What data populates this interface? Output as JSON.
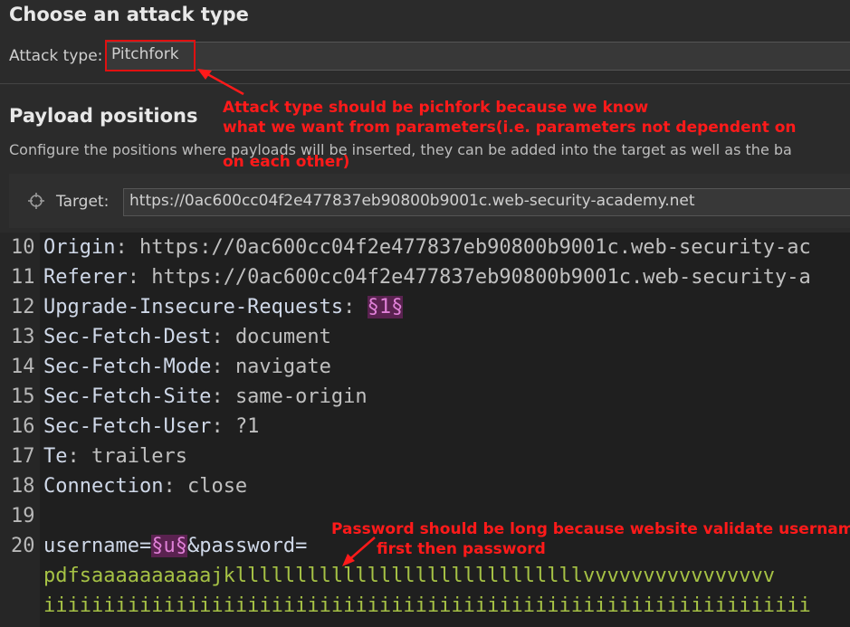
{
  "attack_type_section": {
    "title": "Choose an attack type",
    "label": "Attack type:",
    "value": "Pitchfork"
  },
  "payload_section": {
    "title": "Payload positions",
    "description": "Configure the positions where payloads will be inserted, they can be added into the target as well as the ba"
  },
  "target": {
    "label": "Target:",
    "url": "https://0ac600cc04f2e477837eb90800b9001c.web-security-academy.net"
  },
  "annotations": {
    "attack_type_note": [
      "Attack type should be pichfork because we know",
      "what we want from parameters(i.e. parameters not dependent on",
      "on each other)"
    ],
    "password_note": [
      "Password should be long because website validate username",
      "first then password"
    ],
    "color": "#ff1a1a"
  },
  "request_lines": [
    {
      "num": "10",
      "key": "Origin",
      "sep": ": ",
      "val": "https://0ac600cc04f2e477837eb90800b9001c.web-security-ac"
    },
    {
      "num": "11",
      "key": "Referer",
      "sep": ": ",
      "val": "https://0ac600cc04f2e477837eb90800b9001c.web-security-a"
    },
    {
      "num": "12",
      "key": "Upgrade-Insecure-Requests",
      "sep": ": ",
      "marker": "§1§"
    },
    {
      "num": "13",
      "key": "Sec-Fetch-Dest",
      "sep": ": ",
      "val": "document"
    },
    {
      "num": "14",
      "key": "Sec-Fetch-Mode",
      "sep": ": ",
      "val": "navigate"
    },
    {
      "num": "15",
      "key": "Sec-Fetch-Site",
      "sep": ": ",
      "val": "same-origin"
    },
    {
      "num": "16",
      "key": "Sec-Fetch-User",
      "sep": ": ",
      "val": "?1"
    },
    {
      "num": "17",
      "key": "Te",
      "sep": ": ",
      "val": "trailers"
    },
    {
      "num": "18",
      "key": "Connection",
      "sep": ": ",
      "val": "close"
    },
    {
      "num": "19"
    },
    {
      "num": "20",
      "body_prefix": "username=",
      "marker": "§u§",
      "body_suffix": "&password="
    }
  ],
  "password_lines": [
    "pdfsaaaaaaaaaajklllllllllllllllllllllllllllllvvvvvvvvvvvvvvvv",
    "iiiiiiiiiiiiiiiiiiiiiiiiiiiiiiiiiiiiiiiiiiiiiiiiiiiiiiiiiiiiiiii"
  ]
}
